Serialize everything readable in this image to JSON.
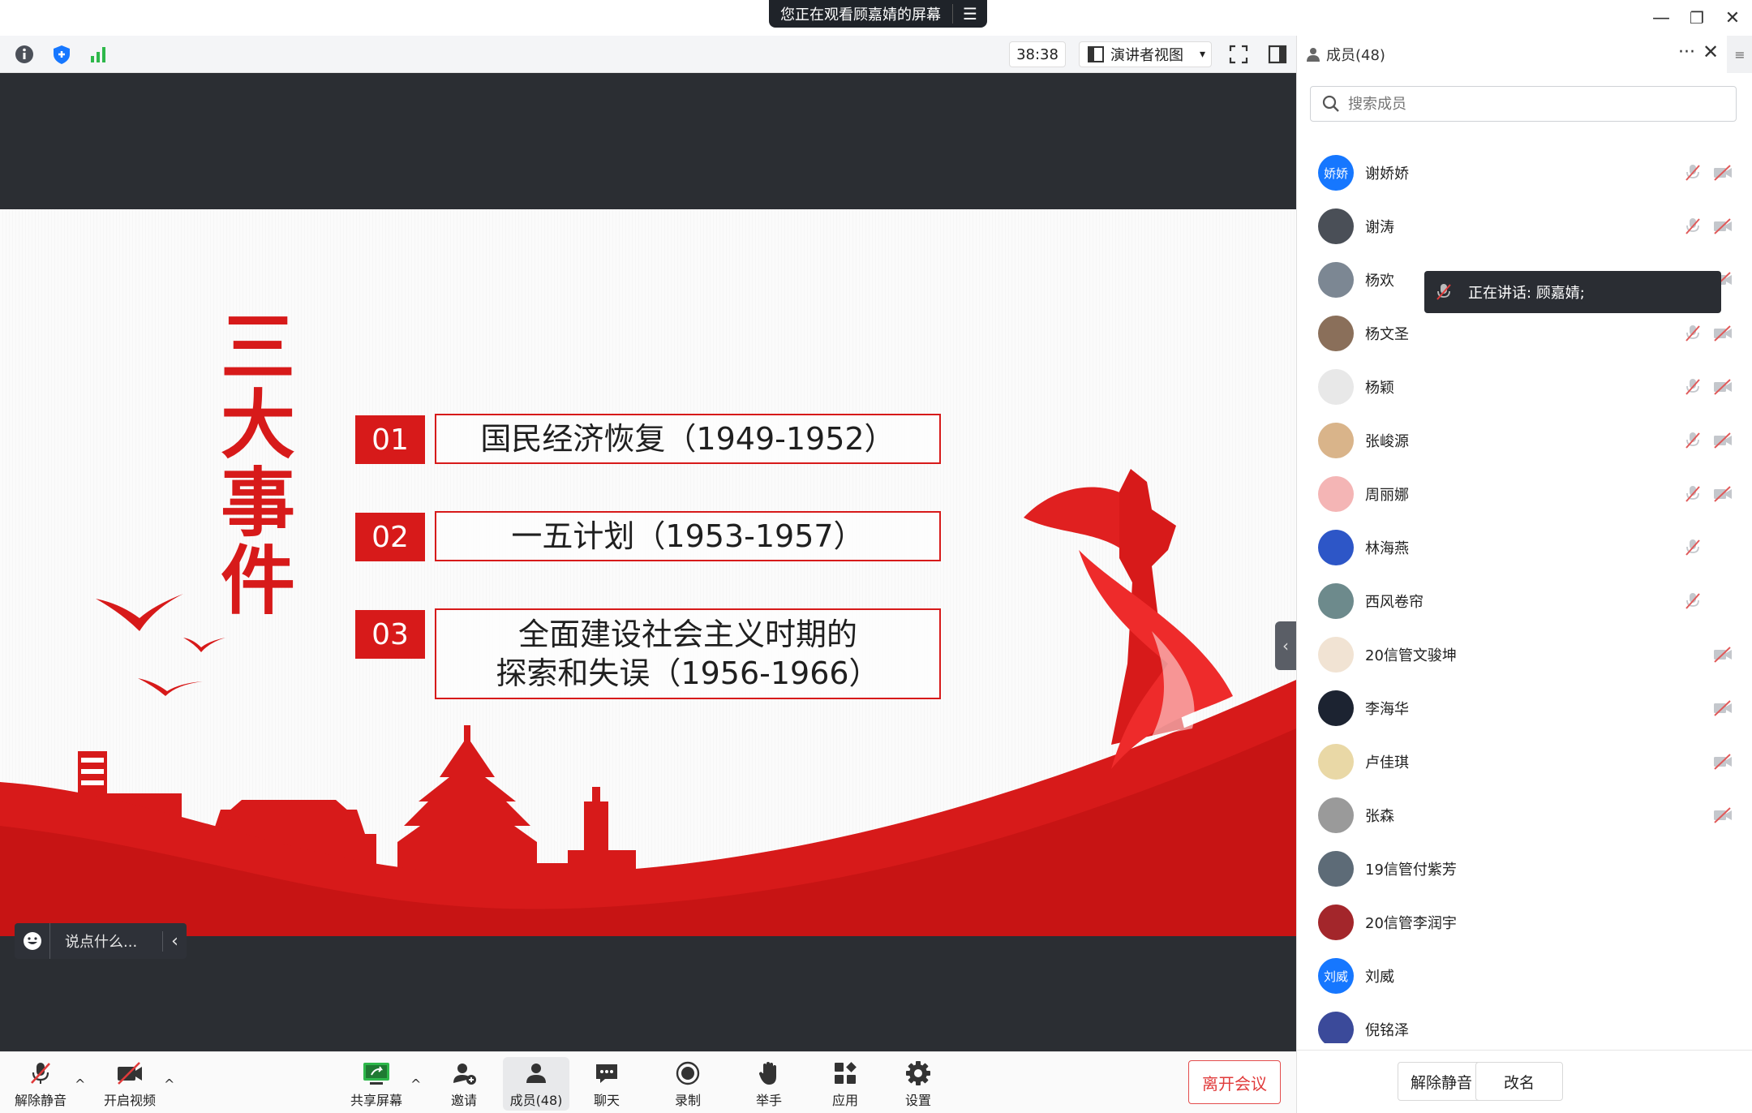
{
  "window": {
    "share_notice": "您正在观看顾嘉婧的屏幕",
    "minimize_glyph": "—",
    "restore_glyph": "❐",
    "close_glyph": "✕"
  },
  "toolbar": {
    "icons": [
      "info-icon",
      "shield-icon",
      "signal-icon"
    ],
    "timer": "38:38",
    "view_label": "演讲者视图",
    "view_caret": "▾"
  },
  "slide": {
    "title": "三大事件",
    "items": [
      {
        "num": "01",
        "text": "国民经济恢复（1949-1952）"
      },
      {
        "num": "02",
        "text": "一五计划（1953-1957）"
      },
      {
        "num": "03",
        "line1": "全面建设社会主义时期的",
        "line2": "探索和失误（1956-1966）"
      }
    ]
  },
  "chat": {
    "placeholder": "说点什么...",
    "chevron": "‹"
  },
  "controls": {
    "unmute": "解除静音",
    "start_video": "开启视频",
    "share_screen": "共享屏幕",
    "invite": "邀请",
    "members": "成员(48)",
    "chat": "聊天",
    "record": "录制",
    "raise_hand": "举手",
    "apps": "应用",
    "settings": "设置",
    "leave": "离开会议",
    "caret": "^"
  },
  "panel": {
    "title": "成员(48)",
    "more": "···",
    "close": "✕",
    "side": "≡",
    "search_placeholder": "搜索成员",
    "speaking_tooltip": "正在讲话: 顾嘉婧;",
    "members": [
      {
        "name": "谢娇娇",
        "avatar_text": "娇娇",
        "color": "#1677ff",
        "mic": true,
        "cam": true
      },
      {
        "name": "谢涛",
        "avatar_text": "",
        "color": "#4a4f57",
        "mic": true,
        "cam": true
      },
      {
        "name": "杨欢",
        "avatar_text": "",
        "color": "#7c8793",
        "mic": true,
        "cam": true
      },
      {
        "name": "杨文圣",
        "avatar_text": "",
        "color": "#8a6f5a",
        "mic": true,
        "cam": true
      },
      {
        "name": "杨颖",
        "avatar_text": "",
        "color": "#e8e8e8",
        "mic": true,
        "cam": true
      },
      {
        "name": "张峻源",
        "avatar_text": "",
        "color": "#d9b48a",
        "mic": true,
        "cam": true
      },
      {
        "name": "周丽娜",
        "avatar_text": "",
        "color": "#f4b5b5",
        "mic": true,
        "cam": true
      },
      {
        "name": "林海燕",
        "avatar_text": "",
        "color": "#2d56c7",
        "mic": true,
        "cam": false
      },
      {
        "name": "西风卷帘",
        "avatar_text": "",
        "color": "#6d8a8c",
        "mic": true,
        "cam": false
      },
      {
        "name": "20信管文骏坤",
        "avatar_text": "",
        "color": "#f1e3d3",
        "mic": false,
        "cam": true
      },
      {
        "name": "李海华",
        "avatar_text": "",
        "color": "#1c2331",
        "mic": false,
        "cam": true
      },
      {
        "name": "卢佳琪",
        "avatar_text": "",
        "color": "#e9d8a6",
        "mic": false,
        "cam": true
      },
      {
        "name": "张森",
        "avatar_text": "",
        "color": "#9a9a9a",
        "mic": false,
        "cam": true
      },
      {
        "name": "19信管付紫芳",
        "avatar_text": "",
        "color": "#5d6b77",
        "mic": false,
        "cam": false
      },
      {
        "name": "20信管李润宇",
        "avatar_text": "",
        "color": "#a3262b",
        "mic": false,
        "cam": false
      },
      {
        "name": "刘威",
        "avatar_text": "刘威",
        "color": "#1677ff",
        "mic": false,
        "cam": false
      },
      {
        "name": "倪铭泽",
        "avatar_text": "",
        "color": "#3b4a9a",
        "mic": false,
        "cam": false
      }
    ],
    "unmute_btn": "解除静音",
    "rename_btn": "改名"
  },
  "colors": {
    "accent_red": "#d71a1a",
    "brand_blue": "#1677ff"
  }
}
